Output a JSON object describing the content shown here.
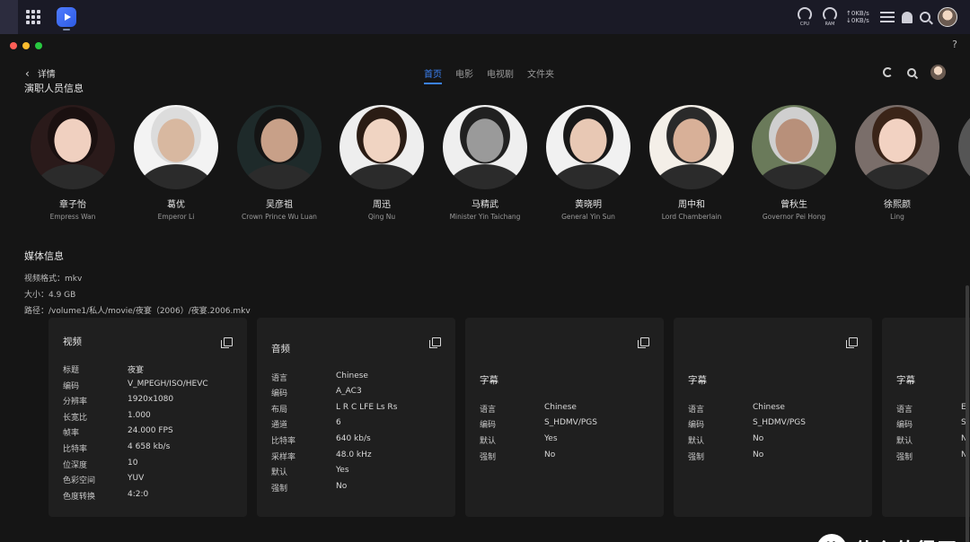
{
  "topbar": {
    "cpu_label": "CPU",
    "ram_label": "RAM",
    "net_up": "↑0KB/s",
    "net_down": "↓0KB/s"
  },
  "window": {
    "help": "?"
  },
  "header": {
    "back_label": "详情",
    "tabs": [
      {
        "label": "首页",
        "active": true
      },
      {
        "label": "电影",
        "active": false
      },
      {
        "label": "电视剧",
        "active": false
      },
      {
        "label": "文件夹",
        "active": false
      }
    ]
  },
  "cast": {
    "heading": "演职人员信息",
    "items": [
      {
        "name": "章子怡",
        "role": "Empress Wan",
        "bg": "#2a1a1a",
        "skin": "#f0d0c0",
        "hair": "#1a1010"
      },
      {
        "name": "葛优",
        "role": "Emperor Li",
        "bg": "#f3f3f3",
        "skin": "#d8b8a0",
        "hair": "#dcdcdc"
      },
      {
        "name": "吴彦祖",
        "role": "Crown Prince Wu Luan",
        "bg": "#1e2a2a",
        "skin": "#c8a088",
        "hair": "#141414"
      },
      {
        "name": "周迅",
        "role": "Qing Nu",
        "bg": "#eeeeee",
        "skin": "#f0d4c2",
        "hair": "#2a1c14"
      },
      {
        "name": "马精武",
        "role": "Minister Yin Taichang",
        "bg": "#efefef",
        "skin": "#9a9a9a",
        "hair": "#202020"
      },
      {
        "name": "黄晓明",
        "role": "General Yin Sun",
        "bg": "#f1f1f1",
        "skin": "#e8c8b4",
        "hair": "#181818"
      },
      {
        "name": "周中和",
        "role": "Lord Chamberlain",
        "bg": "#f4efe8",
        "skin": "#d8b098",
        "hair": "#2a2a2a"
      },
      {
        "name": "曾秋生",
        "role": "Governor Pei Hong",
        "bg": "#6a7a5a",
        "skin": "#b8907a",
        "hair": "#cfcfcf"
      },
      {
        "name": "徐熙颜",
        "role": "Ling",
        "bg": "#7a6e6a",
        "skin": "#f2d2c2",
        "hair": "#3a2418"
      }
    ]
  },
  "media": {
    "title": "媒体信息",
    "format": "视频格式：mkv",
    "size": "大小：4.9 GB",
    "path": "路径：/volume1/私人/movie/夜宴（2006）/夜宴.2006.mkv"
  },
  "cards": {
    "video": {
      "title": "视频",
      "rows": [
        {
          "k": "标题",
          "v": "夜宴"
        },
        {
          "k": "编码",
          "v": "V_MPEGH/ISO/HEVC"
        },
        {
          "k": "分辨率",
          "v": "1920x1080"
        },
        {
          "k": "长宽比",
          "v": "1.000"
        },
        {
          "k": "帧率",
          "v": "24.000 FPS"
        },
        {
          "k": "比特率",
          "v": "4 658 kb/s"
        },
        {
          "k": "位深度",
          "v": "10"
        },
        {
          "k": "色彩空间",
          "v": "YUV"
        },
        {
          "k": "色度转换",
          "v": "4:2:0"
        }
      ]
    },
    "audio": {
      "title": "音频",
      "rows": [
        {
          "k": "语言",
          "v": "Chinese"
        },
        {
          "k": "编码",
          "v": "A_AC3"
        },
        {
          "k": "布局",
          "v": "L R C LFE Ls Rs"
        },
        {
          "k": "通道",
          "v": "6"
        },
        {
          "k": "比特率",
          "v": "640 kb/s"
        },
        {
          "k": "采样率",
          "v": "48.0 kHz"
        },
        {
          "k": "默认",
          "v": "Yes"
        },
        {
          "k": "强制",
          "v": "No"
        }
      ]
    },
    "sub1": {
      "title": "字幕",
      "rows": [
        {
          "k": "语言",
          "v": "Chinese"
        },
        {
          "k": "编码",
          "v": "S_HDMV/PGS"
        },
        {
          "k": "默认",
          "v": "Yes"
        },
        {
          "k": "强制",
          "v": "No"
        }
      ]
    },
    "sub2": {
      "title": "字幕",
      "rows": [
        {
          "k": "语言",
          "v": "Chinese"
        },
        {
          "k": "编码",
          "v": "S_HDMV/PGS"
        },
        {
          "k": "默认",
          "v": "No"
        },
        {
          "k": "强制",
          "v": "No"
        }
      ]
    },
    "sub3": {
      "title": "字幕",
      "rows": [
        {
          "k": "语言",
          "v": "E"
        },
        {
          "k": "编码",
          "v": "S"
        },
        {
          "k": "默认",
          "v": "N"
        },
        {
          "k": "强制",
          "v": "N"
        }
      ]
    }
  },
  "watermark": {
    "badge": "值",
    "text": "什么值得买"
  }
}
